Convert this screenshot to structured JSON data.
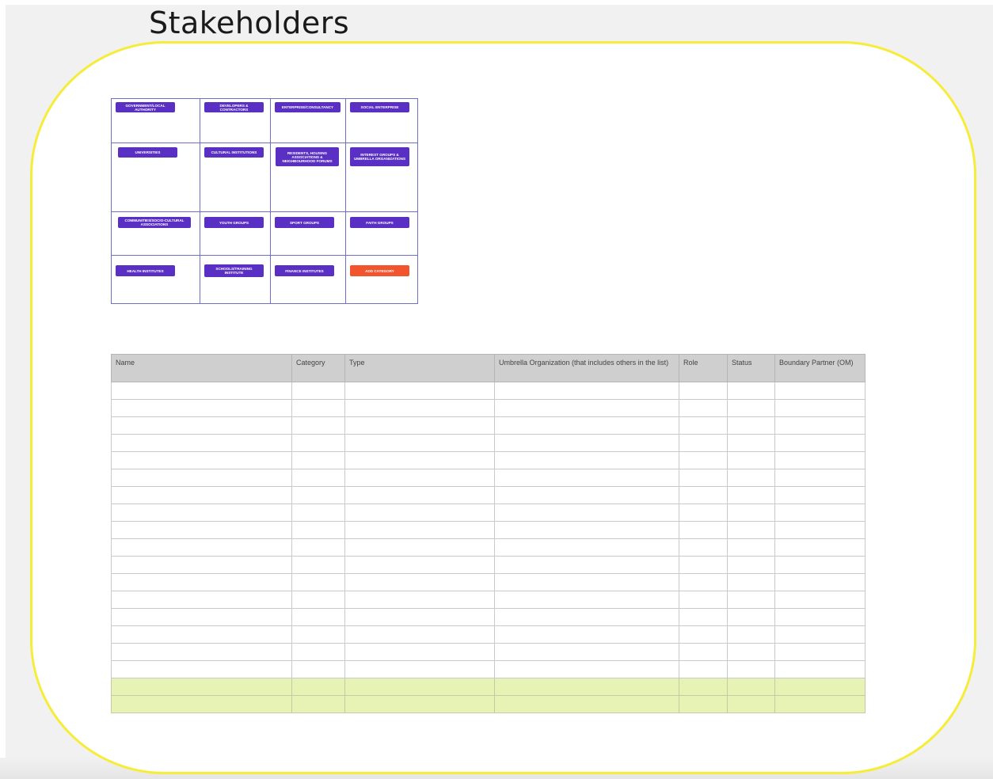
{
  "page": {
    "title": "Stakeholders"
  },
  "colors": {
    "frame": "#f6ec3b",
    "tag": "#5a2fc4",
    "add_tag": "#f2542d",
    "highlight_row": "#e6f3b4",
    "grid_line": "#6f6fc7"
  },
  "categories": [
    [
      "Government/Local Authority",
      "Developers & Contractors",
      "Enterprise/Consultancy",
      "Social Enterprise"
    ],
    [
      "Universities",
      "Cultural Institutions",
      "Residents, Housing Associations & Neighbourhood Forums",
      "Interest Groups & Umbrella Organizations"
    ],
    [
      "Communities/Socio-Cultural Associations",
      "Youth Groups",
      "Sport Groups",
      "Faith Groups"
    ],
    [
      "Health Institutes",
      "Schools/Training Institute",
      "Finance Institutes",
      "Add Category"
    ]
  ],
  "table": {
    "headers": [
      "Name",
      "Category",
      "Type",
      "Umbrella Organization (that includes others in the list)",
      "Role",
      "Status",
      "Boundary Partner (OM)"
    ],
    "empty_rows": 17,
    "highlight_rows": 2
  }
}
